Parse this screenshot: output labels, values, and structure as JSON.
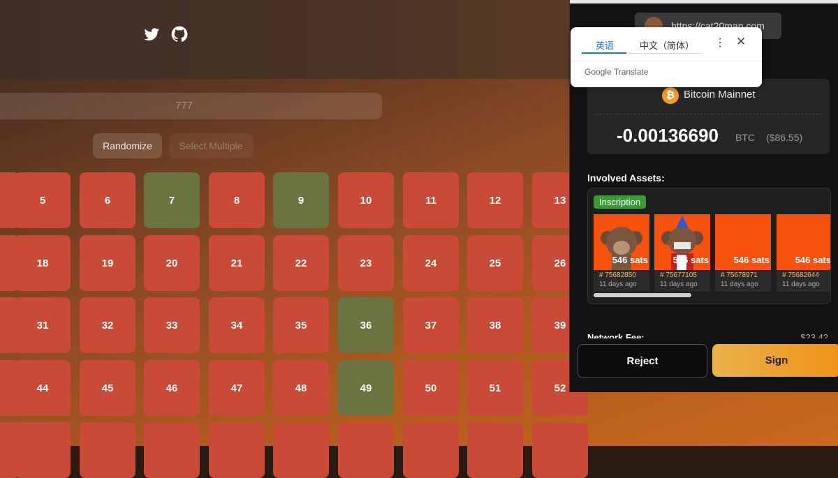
{
  "page": {
    "search_value": "777",
    "randomize_label": "Randomize",
    "select_multiple_label": "Select Multiple"
  },
  "social": {
    "icons": [
      "twitter-icon",
      "github-icon"
    ]
  },
  "grid": {
    "rows": [
      [
        "5",
        "6",
        "7",
        "8",
        "9",
        "10",
        "11",
        "12",
        "13"
      ],
      [
        "18",
        "19",
        "20",
        "21",
        "22",
        "23",
        "24",
        "25",
        "26"
      ],
      [
        "31",
        "32",
        "33",
        "34",
        "35",
        "36",
        "37",
        "38",
        "39"
      ],
      [
        "44",
        "45",
        "46",
        "47",
        "48",
        "49",
        "50",
        "51",
        "52"
      ]
    ],
    "highlighted": [
      "7",
      "9",
      "36",
      "49"
    ],
    "colors": {
      "default": "#c94a36",
      "highlighted": "#6b7440"
    }
  },
  "wallet": {
    "url": "https://cat20map.com",
    "network": "Bitcoin Mainnet",
    "amount": "-0.00136690",
    "unit": "BTC",
    "usd": "($86.55)",
    "assets_title": "Involved Assets:",
    "badge": "Inscription",
    "assets": [
      {
        "sats": "546 sats",
        "number": "# 75682850",
        "ago": "11 days ago"
      },
      {
        "sats": "546 sats",
        "number": "# 75677105",
        "ago": "11 days ago"
      },
      {
        "sats": "546 sats",
        "number": "# 75678971",
        "ago": "11 days ago"
      },
      {
        "sats": "546 sats",
        "number": "# 75682644",
        "ago": "11 days ago"
      }
    ],
    "fee_label": "Network Fee:",
    "fee_value": "$23.42",
    "reject_label": "Reject",
    "sign_label": "Sign",
    "accent": "#f09218"
  },
  "translate": {
    "tab_source": "英语",
    "tab_target": "中文（简体）",
    "brand": "Google Translate"
  }
}
